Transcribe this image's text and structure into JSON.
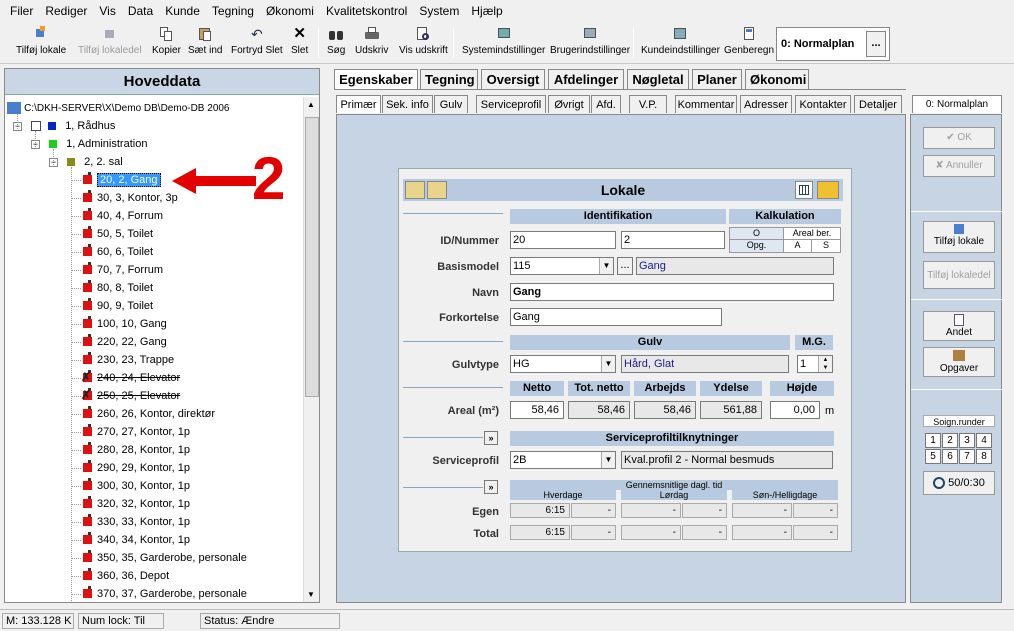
{
  "menu": [
    "Filer",
    "Rediger",
    "Vis",
    "Data",
    "Kunde",
    "Tegning",
    "Økonomi",
    "Kvalitetskontrol",
    "System",
    "Hjælp"
  ],
  "toolbar": {
    "tilfoej_lokale": "Tilføj lokale",
    "tilfoej_lokaledel": "Tilføj lokaledel",
    "kopier": "Kopier",
    "saet_ind": "Sæt ind",
    "fortryd_slet": "Fortryd Slet",
    "slet": "Slet",
    "soeg": "Søg",
    "udskriv": "Udskriv",
    "vis_udskrift": "Vis udskrift",
    "systemindstillinger": "Systemindstillinger",
    "brugerindstillinger": "Brugerindstillinger",
    "kundeindstillinger": "Kundeindstillinger",
    "genberegn": "Genberegn",
    "plan_value": "0: Normalplan",
    "plan_btn": "..."
  },
  "left": {
    "title": "Hoveddata",
    "root": "C:\\DKH-SERVER\\X\\Demo DB\\Demo-DB 2006",
    "n1": "1, Rådhus",
    "n2": "1, Administration",
    "n3": "2, 2. sal",
    "rooms": [
      "20, 2, Gang",
      "30, 3, Kontor, 3p",
      "40, 4, Forrum",
      "50, 5, Toilet",
      "60, 6, Toilet",
      "70, 7, Forrum",
      "80, 8, Toilet",
      "90, 9, Toilet",
      "100, 10, Gang",
      "220, 22, Gang",
      "230, 23, Trappe",
      "240, 24, Elevator",
      "250, 25, Elevator",
      "260, 26, Kontor, direktør",
      "270, 27, Kontor, 1p",
      "280, 28, Kontor, 1p",
      "290, 29, Kontor, 1p",
      "300, 30, Kontor, 1p",
      "320, 32, Kontor, 1p",
      "330, 33, Kontor, 1p",
      "340, 34, Kontor, 1p",
      "350, 35, Garderobe, personale",
      "360, 36, Depot",
      "370, 37, Garderobe, personale"
    ]
  },
  "annotation": "2",
  "tabs_main": [
    "Egenskaber",
    "Tegning",
    "Oversigt",
    "Afdelinger",
    "Nøgletal",
    "Planer",
    "Økonomi"
  ],
  "tabs_sub": [
    "Primær",
    "Sek. info",
    "Gulv",
    "Serviceprofil",
    "Øvrigt",
    "Afd.",
    "V.P.",
    "Kommentar",
    "Adresser",
    "Kontakter",
    "Detaljer"
  ],
  "plan_tab": "0: Normalplan",
  "lokale": {
    "title": "Lokale",
    "sec_ident": "Identifikation",
    "sec_kalk": "Kalkulation",
    "kalk_o": "O",
    "kalk_areal": "Areal ber.",
    "kalk_opg": "Opg.",
    "kalk_a": "A",
    "kalk_s": "S",
    "lbl_id": "ID/Nummer",
    "id": "20",
    "nummer": "2",
    "lbl_basis": "Basismodel",
    "basis": "115",
    "basis_btn": "...",
    "basis_name": "Gang",
    "lbl_navn": "Navn",
    "navn": "Gang",
    "lbl_fork": "Forkortelse",
    "fork": "Gang",
    "sec_gulv": "Gulv",
    "sec_mg": "M.G.",
    "lbl_gulvtype": "Gulvtype",
    "gulvtype": "HG",
    "gulv_name": "Hård, Glat",
    "mg": "1",
    "h_netto": "Netto",
    "h_totnetto": "Tot. netto",
    "h_arbejds": "Arbejds",
    "h_ydelse": "Ydelse",
    "h_hoejde": "Højde",
    "lbl_areal": "Areal (m²)",
    "netto": "58,46",
    "totnetto": "58,46",
    "arbejds": "58,46",
    "ydelse": "561,88",
    "hoejde": "0,00",
    "unit_m": "m",
    "sec_sp": "Serviceprofiltilknytninger",
    "lbl_sp": "Serviceprofil",
    "sp": "2B",
    "sp_name": "Kval.profil 2 - Normal besmuds",
    "sec_tid": "Gennemsnitlige dagl. tid",
    "h_hverdage": "Hverdage",
    "h_loerdag": "Lørdag",
    "h_soen": "Søn-/Helligdage",
    "lbl_egen": "Egen",
    "egen": [
      "6:15",
      "-",
      "-",
      "-",
      "-",
      "-"
    ],
    "lbl_total": "Total",
    "total": [
      "6:15",
      "-",
      "-",
      "-",
      "-",
      "-"
    ],
    "arrow": "»"
  },
  "right": {
    "ok": "OK",
    "annuller": "Annuller",
    "tilfoej_lokale": "Tilføj lokale",
    "tilfoej_lokaledel": "Tilføj lokaledel",
    "andet": "Andet",
    "opgaver": "Opgaver",
    "soign": "Soign.runder",
    "runder": [
      "1",
      "2",
      "3",
      "4",
      "5",
      "6",
      "7",
      "8"
    ],
    "timer": "50/0:30"
  },
  "status": {
    "mem": "M: 133.128 K",
    "num": "Num lock: Til",
    "status": "Status: Ændre"
  }
}
